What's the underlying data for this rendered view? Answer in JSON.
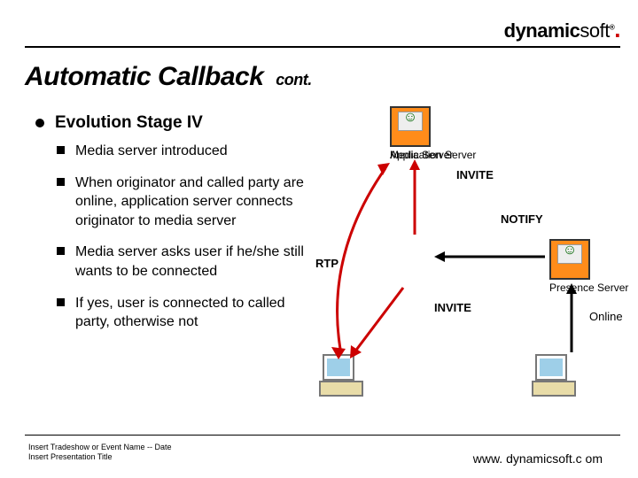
{
  "logo": {
    "bold": "dynamic",
    "light": "soft",
    "dot": "."
  },
  "title": {
    "main": "Automatic Callback",
    "cont": "cont."
  },
  "heading": "Evolution Stage IV",
  "bullets": [
    "Media server introduced",
    "When originator and called party are online, application server connects originator to media server",
    "Media server asks user if he/she still wants to be connected",
    "If yes, user is connected to called party, otherwise not"
  ],
  "diagram": {
    "media_server": "Media Server",
    "application_server": "Application Server",
    "presence_server": "Presence Server",
    "invite1": "INVITE",
    "invite2": "INVITE",
    "notify": "NOTIFY",
    "rtp": "RTP",
    "online": "Online"
  },
  "footer": {
    "line1": "Insert Tradeshow or Event Name  --  Date",
    "line2": "Insert Presentation Title",
    "url": "www. dynamicsoft.c om"
  }
}
